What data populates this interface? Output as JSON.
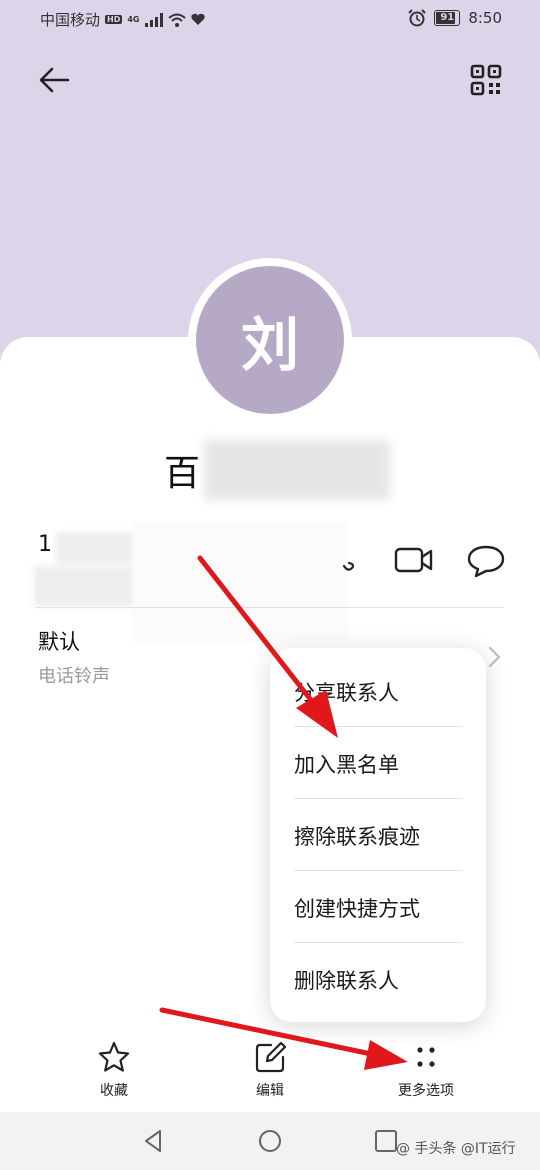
{
  "status_bar": {
    "carrier": "中国移动",
    "hd_badge": "HD",
    "network": "4G",
    "battery": "91",
    "time": "8:50"
  },
  "contact": {
    "avatar_initial": "刘",
    "name_visible": "百",
    "phone_visible": "1"
  },
  "ringtone": {
    "value": "默认",
    "label": "电话铃声"
  },
  "menu": {
    "items": [
      {
        "label": "分享联系人"
      },
      {
        "label": "加入黑名单"
      },
      {
        "label": "擦除联系痕迹"
      },
      {
        "label": "创建快捷方式"
      },
      {
        "label": "删除联系人"
      }
    ]
  },
  "actions": {
    "favorite": "收藏",
    "edit": "编辑",
    "more": "更多选项"
  },
  "watermark": "@ 手头条 @IT运行",
  "colors": {
    "header_bg": "#dcd4e8",
    "avatar_bg": "#b5a9c5",
    "annotation_arrow": "#e0181b"
  }
}
